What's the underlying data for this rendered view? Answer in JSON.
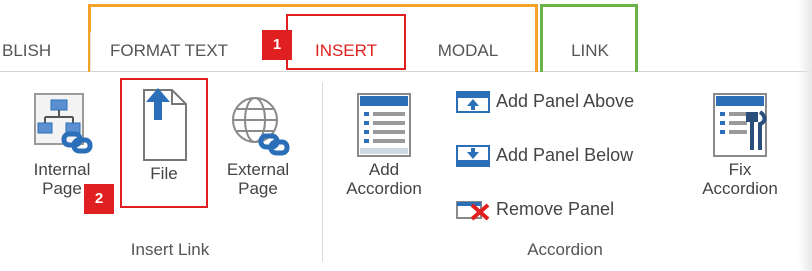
{
  "tabs": {
    "publish": "BLISH",
    "format_text": "FORMAT TEXT",
    "insert": "INSERT",
    "modal": "MODAL",
    "link": "LINK"
  },
  "badges": {
    "one": "1",
    "two": "2"
  },
  "insert_link_group": {
    "label": "Insert Link",
    "internal_page": {
      "line1": "Internal",
      "line2": "Page"
    },
    "file": {
      "line1": "File"
    },
    "external_page": {
      "line1": "External",
      "line2": "Page"
    }
  },
  "accordion_group": {
    "label": "Accordion",
    "add_accordion": {
      "line1": "Add",
      "line2": "Accordion"
    },
    "add_panel_above": "Add Panel Above",
    "add_panel_below": "Add Panel Below",
    "remove_panel": "Remove Panel",
    "fix_accordion": {
      "line1": "Fix",
      "line2": "Accordion"
    }
  },
  "colors": {
    "accent_red": "#e02020",
    "tab_group_orange": "#f4a328",
    "tab_group_green": "#6cb24a",
    "icon_blue": "#2a6fb7"
  }
}
